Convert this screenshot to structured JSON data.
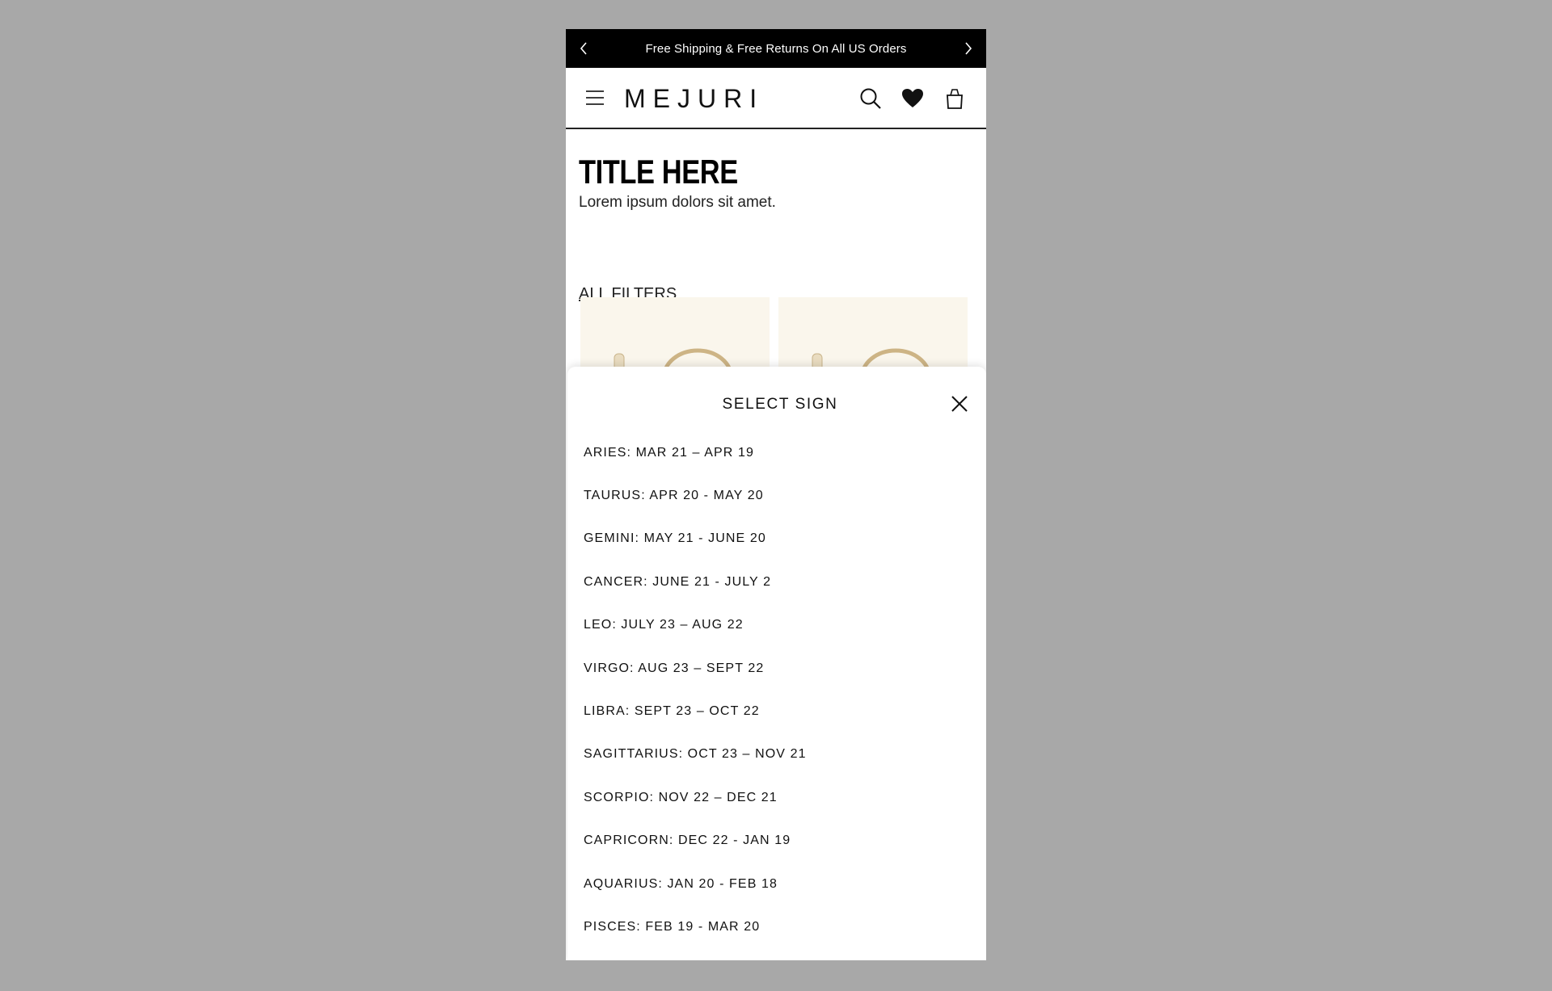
{
  "promo": {
    "text": "Free Shipping & Free Returns On All US Orders"
  },
  "header": {
    "logo": "MEJURI"
  },
  "page": {
    "title": "TITLE HERE",
    "subtitle": "Lorem ipsum dolors sit amet.",
    "filters_link": "ALL FILTERS"
  },
  "sheet": {
    "title": "SELECT SIGN",
    "signs": [
      "ARIES: MAR 21 – APR 19",
      "TAURUS: APR 20 - MAY 20",
      "GEMINI: MAY 21 - JUNE 20",
      "CANCER: JUNE 21 - JULY 2",
      "LEO: JULY 23 – AUG 22",
      "VIRGO: AUG 23 – SEPT 22",
      "LIBRA: SEPT 23 – OCT 22",
      "SAGITTARIUS: OCT 23 – NOV 21",
      "SCORPIO: NOV 22 – DEC 21",
      "CAPRICORN: DEC 22 - JAN 19",
      "AQUARIUS: JAN 20 - FEB 18",
      "PISCES: FEB 19 - MAR 20"
    ]
  },
  "colors": {
    "promo_bg": "#000000",
    "page_bg": "#ffffff",
    "backdrop": "#a8a8a8",
    "card_bg": "#faf6ec"
  },
  "icons": [
    "chevron-left-icon",
    "chevron-right-icon",
    "menu-icon",
    "search-icon",
    "heart-icon",
    "bag-icon",
    "close-icon"
  ]
}
